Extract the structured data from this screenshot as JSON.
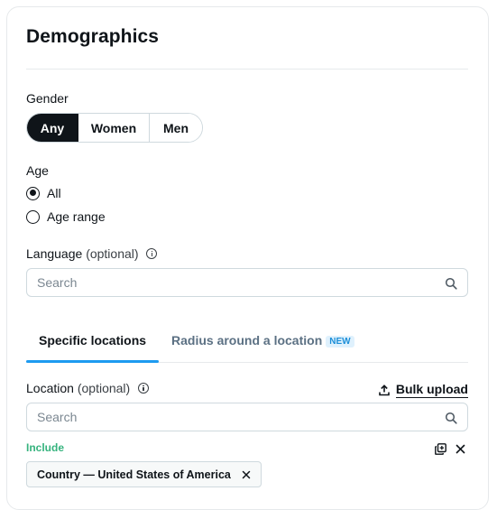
{
  "title": "Demographics",
  "gender": {
    "label": "Gender",
    "options": [
      "Any",
      "Women",
      "Men"
    ],
    "selected": "Any"
  },
  "age": {
    "label": "Age",
    "options": [
      "All",
      "Age range"
    ],
    "selected": "All"
  },
  "language": {
    "label": "Language",
    "optional": "(optional)",
    "placeholder": "Search"
  },
  "tabs": {
    "specific": "Specific locations",
    "radius": "Radius around a location",
    "new_badge": "NEW",
    "active": "Specific locations"
  },
  "location": {
    "label": "Location",
    "optional": "(optional)",
    "bulk_upload": "Bulk upload",
    "placeholder": "Search",
    "include_label": "Include",
    "chips": [
      "Country — United States of America"
    ]
  },
  "colors": {
    "accent": "#1d9bf0",
    "include": "#36b37e",
    "active_segment": "#0f1419"
  }
}
